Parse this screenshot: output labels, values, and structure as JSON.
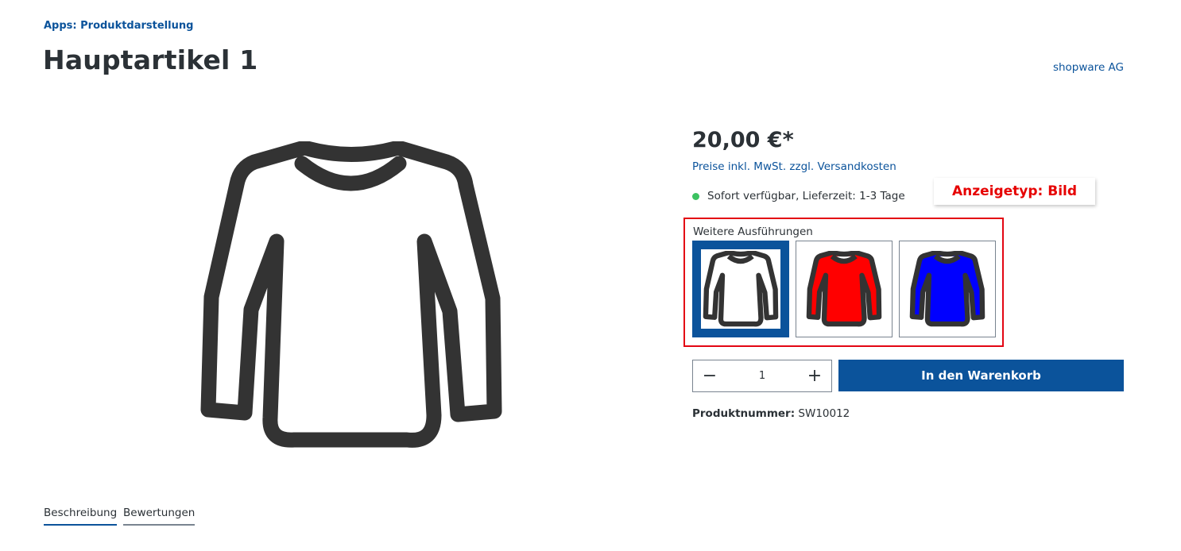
{
  "breadcrumb": "Apps: Produktdarstellung",
  "product": {
    "title": "Hauptartikel 1",
    "manufacturer": "shopware AG",
    "price": "20,00 €*",
    "tax_note": "Preise inkl. MwSt. zzgl. Versandkosten",
    "delivery": "Sofort verfügbar, Lieferzeit: 1-3 Tage",
    "number_label": "Produktnummer:",
    "number_value": "SW10012",
    "image_icon": "long-sleeve-shirt-icon"
  },
  "annotation": {
    "label": "Anzeigetyp: Bild",
    "color": "#e60000"
  },
  "variants": {
    "label": "Weitere Ausführungen",
    "items": [
      {
        "color": "#ffffff",
        "selected": true
      },
      {
        "color": "#ff0000",
        "selected": false
      },
      {
        "color": "#0000ff",
        "selected": false
      }
    ]
  },
  "quantity": {
    "minus_icon": "minus-icon",
    "plus_icon": "plus-icon",
    "minus_symbol": "−",
    "plus_symbol": "+",
    "value": "1"
  },
  "buy_button": "In den Warenkorb",
  "tabs": [
    "Beschreibung",
    "Bewertungen"
  ],
  "colors": {
    "primary": "#0b539b",
    "text": "#2b3136",
    "available": "#3cc261",
    "annotation_frame": "#e30613"
  }
}
